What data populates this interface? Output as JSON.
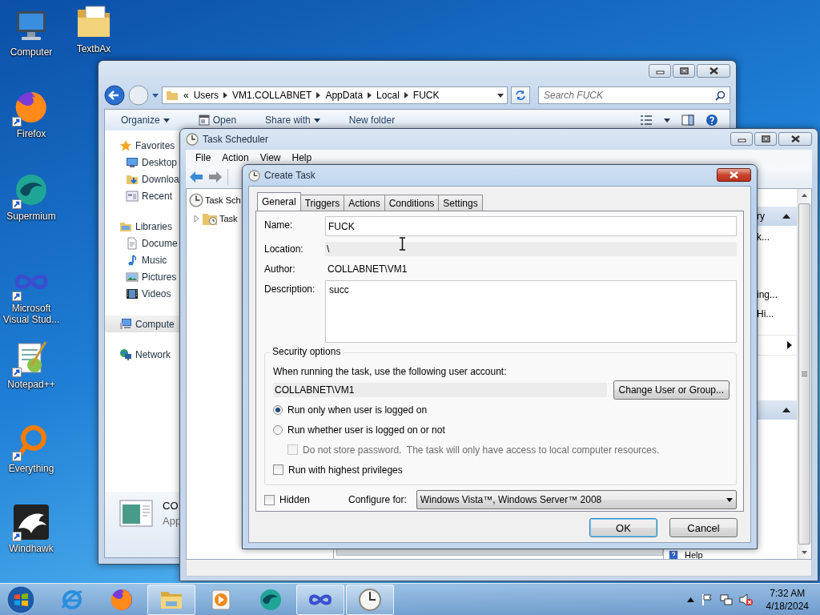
{
  "desktop_icons": [
    {
      "label": "Computer",
      "kind": "computer",
      "shortcut": false
    },
    {
      "label": "TextbAx",
      "kind": "folder",
      "shortcut": false
    },
    {
      "label": "Firefox",
      "kind": "firefox",
      "shortcut": true
    },
    {
      "label": "Supermium",
      "kind": "supermium",
      "shortcut": true
    },
    {
      "label": "Microsoft Visual Stud...",
      "kind": "visualstudio",
      "shortcut": true
    },
    {
      "label": "Notepad++",
      "kind": "notepad",
      "shortcut": true
    },
    {
      "label": "Everything",
      "kind": "everything",
      "shortcut": true
    },
    {
      "label": "Windhawk",
      "kind": "windhawk",
      "shortcut": true
    }
  ],
  "explorer": {
    "breadcrumb_overflow": "«",
    "breadcrumb": [
      "Users",
      "VM1.COLLABNET",
      "AppData",
      "Local",
      "FUCK"
    ],
    "search": {
      "placeholder": "Search FUCK"
    },
    "toolbar": [
      {
        "label": "Organize",
        "kind": "menu"
      },
      {
        "label": "Open",
        "kind": "open"
      },
      {
        "label": "Share with",
        "kind": "menu"
      },
      {
        "label": "New folder",
        "kind": "plain"
      }
    ],
    "nav": [
      {
        "label": "Favorites",
        "kind": "favorites",
        "selected": false,
        "children": [
          {
            "label": "Desktop",
            "kind": "desktop",
            "selected": false
          },
          {
            "label": "Downloa",
            "kind": "downloads",
            "selected": false
          },
          {
            "label": "Recent",
            "kind": "recent",
            "selected": false
          }
        ]
      },
      {
        "label": "Libraries",
        "kind": "libraries",
        "selected": false,
        "children": [
          {
            "label": "Docume",
            "kind": "documents",
            "selected": false
          },
          {
            "label": "Music",
            "kind": "music",
            "selected": false
          },
          {
            "label": "Pictures",
            "kind": "pictures",
            "selected": false
          },
          {
            "label": "Videos",
            "kind": "videos",
            "selected": false
          }
        ]
      },
      {
        "label": "Compute",
        "kind": "computer",
        "selected": true
      },
      {
        "label": "Network",
        "kind": "network",
        "selected": false
      }
    ],
    "details": {
      "name": "CO",
      "type": "App"
    }
  },
  "task_scheduler": {
    "title": "Task Scheduler",
    "menu": [
      "File",
      "Action",
      "View",
      "Help"
    ],
    "tree": {
      "label": "Task Sch",
      "children": [
        {
          "label": "Task",
          "expanded": false
        }
      ]
    },
    "actions": [
      {
        "kind": "header",
        "text": "ry",
        "expanded": true
      },
      {
        "kind": "item",
        "text": "k..."
      },
      {
        "kind": "item",
        "text": "ing..."
      },
      {
        "kind": "item",
        "text": "Hi..."
      },
      {
        "kind": "submenu"
      },
      {
        "kind": "header",
        "expanded": true
      },
      {
        "kind": "help",
        "text": "Help"
      }
    ]
  },
  "dialog": {
    "title": "Create Task",
    "tabs": [
      {
        "label": "General",
        "selected": true
      },
      {
        "label": "Triggers",
        "selected": false
      },
      {
        "label": "Actions",
        "selected": false
      },
      {
        "label": "Conditions",
        "selected": false
      },
      {
        "label": "Settings",
        "selected": false
      }
    ],
    "fields": [
      {
        "label": "Name:",
        "value": "FUCK",
        "kind": "input"
      },
      {
        "label": "Location:",
        "value": "\\",
        "kind": "readonly"
      },
      {
        "label": "Author:",
        "value": "COLLABNET\\VM1",
        "kind": "text"
      },
      {
        "label": "Description:",
        "value": "succ",
        "kind": "textarea"
      }
    ],
    "security": {
      "title": "Security options",
      "prompt": "When running the task, use the following user account:",
      "account": "COLLABNET\\VM1",
      "change_button": "Change User or Group...",
      "options": [
        {
          "kind": "radio",
          "label": "Run only when user is logged on",
          "selected": true,
          "disabled": false
        },
        {
          "kind": "radio",
          "label": "Run whether user is logged on or not",
          "selected": false,
          "disabled": false
        },
        {
          "kind": "checkbox",
          "label": "Do not store password.  The task will only have access to local computer resources.",
          "checked": false,
          "disabled": true
        },
        {
          "kind": "checkbox",
          "label": "Run with highest privileges",
          "checked": false,
          "disabled": false
        }
      ]
    },
    "hidden": {
      "label": "Hidden",
      "checked": false
    },
    "configure": {
      "label": "Configure for:",
      "value": "Windows Vista™, Windows Server™ 2008"
    },
    "buttons": [
      {
        "label": "OK",
        "default": true
      },
      {
        "label": "Cancel",
        "default": false
      }
    ]
  },
  "taskbar": {
    "apps": [
      {
        "kind": "ie",
        "running": false
      },
      {
        "kind": "firefox",
        "running": false
      },
      {
        "kind": "explorer",
        "running": true
      },
      {
        "kind": "media",
        "running": false
      },
      {
        "kind": "supermium",
        "running": false
      },
      {
        "kind": "visualstudio",
        "running": true
      },
      {
        "kind": "clock",
        "running": true
      }
    ],
    "volume_muted": true,
    "time": "7:32 AM",
    "date": "4/18/2024"
  }
}
